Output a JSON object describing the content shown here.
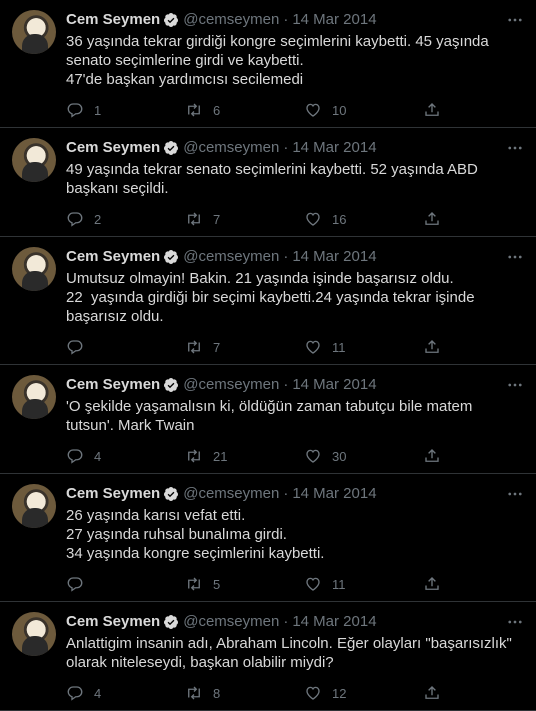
{
  "tweets": [
    {
      "name": "Cem Seymen",
      "handle": "@cemseymen",
      "date": "14 Mar 2014",
      "text": "36 yaşında tekrar girdiği kongre seçimlerini kaybetti. 45 yaşında senato seçimlerine girdi ve kaybetti.\n47'de başkan yardımcısı secilemedi",
      "replies": "1",
      "retweets": "6",
      "likes": "10"
    },
    {
      "name": "Cem Seymen",
      "handle": "@cemseymen",
      "date": "14 Mar 2014",
      "text": "49 yaşında tekrar senato seçimlerini kaybetti. 52 yaşında ABD başkanı seçildi.",
      "replies": "2",
      "retweets": "7",
      "likes": "16"
    },
    {
      "name": "Cem Seymen",
      "handle": "@cemseymen",
      "date": "14 Mar 2014",
      "text": "Umutsuz olmayin! Bakin. 21 yaşında işinde başarısız oldu.\n22  yaşında girdiği bir seçimi kaybetti.24 yaşında tekrar işinde başarısız oldu.",
      "replies": "",
      "retweets": "7",
      "likes": "11"
    },
    {
      "name": "Cem Seymen",
      "handle": "@cemseymen",
      "date": "14 Mar 2014",
      "text": "'O şekilde yaşamalısın ki, öldüğün zaman tabutçu bile matem tutsun'. Mark Twain",
      "replies": "4",
      "retweets": "21",
      "likes": "30"
    },
    {
      "name": "Cem Seymen",
      "handle": "@cemseymen",
      "date": "14 Mar 2014",
      "text": "26 yaşında karısı vefat etti.\n27 yaşında ruhsal bunalıma girdi.\n34 yaşında kongre seçimlerini kaybetti.",
      "replies": "",
      "retweets": "5",
      "likes": "11"
    },
    {
      "name": "Cem Seymen",
      "handle": "@cemseymen",
      "date": "14 Mar 2014",
      "text": "Anlattigim insanin adı, Abraham Lincoln. Eğer olayları \"başarısızlık\" olarak niteleseydi, başkan olabilir miydi?",
      "replies": "4",
      "retweets": "8",
      "likes": "12"
    }
  ],
  "colors": {
    "background": "#000000",
    "text": "#d9d9d9",
    "muted": "#6e767d",
    "border": "#2f3336",
    "verified": "#d9d9d9"
  },
  "icons": {
    "reply": "reply-icon",
    "retweet": "retweet-icon",
    "like": "heart-icon",
    "share": "share-icon",
    "more": "more-icon",
    "verified": "verified-badge-icon"
  }
}
